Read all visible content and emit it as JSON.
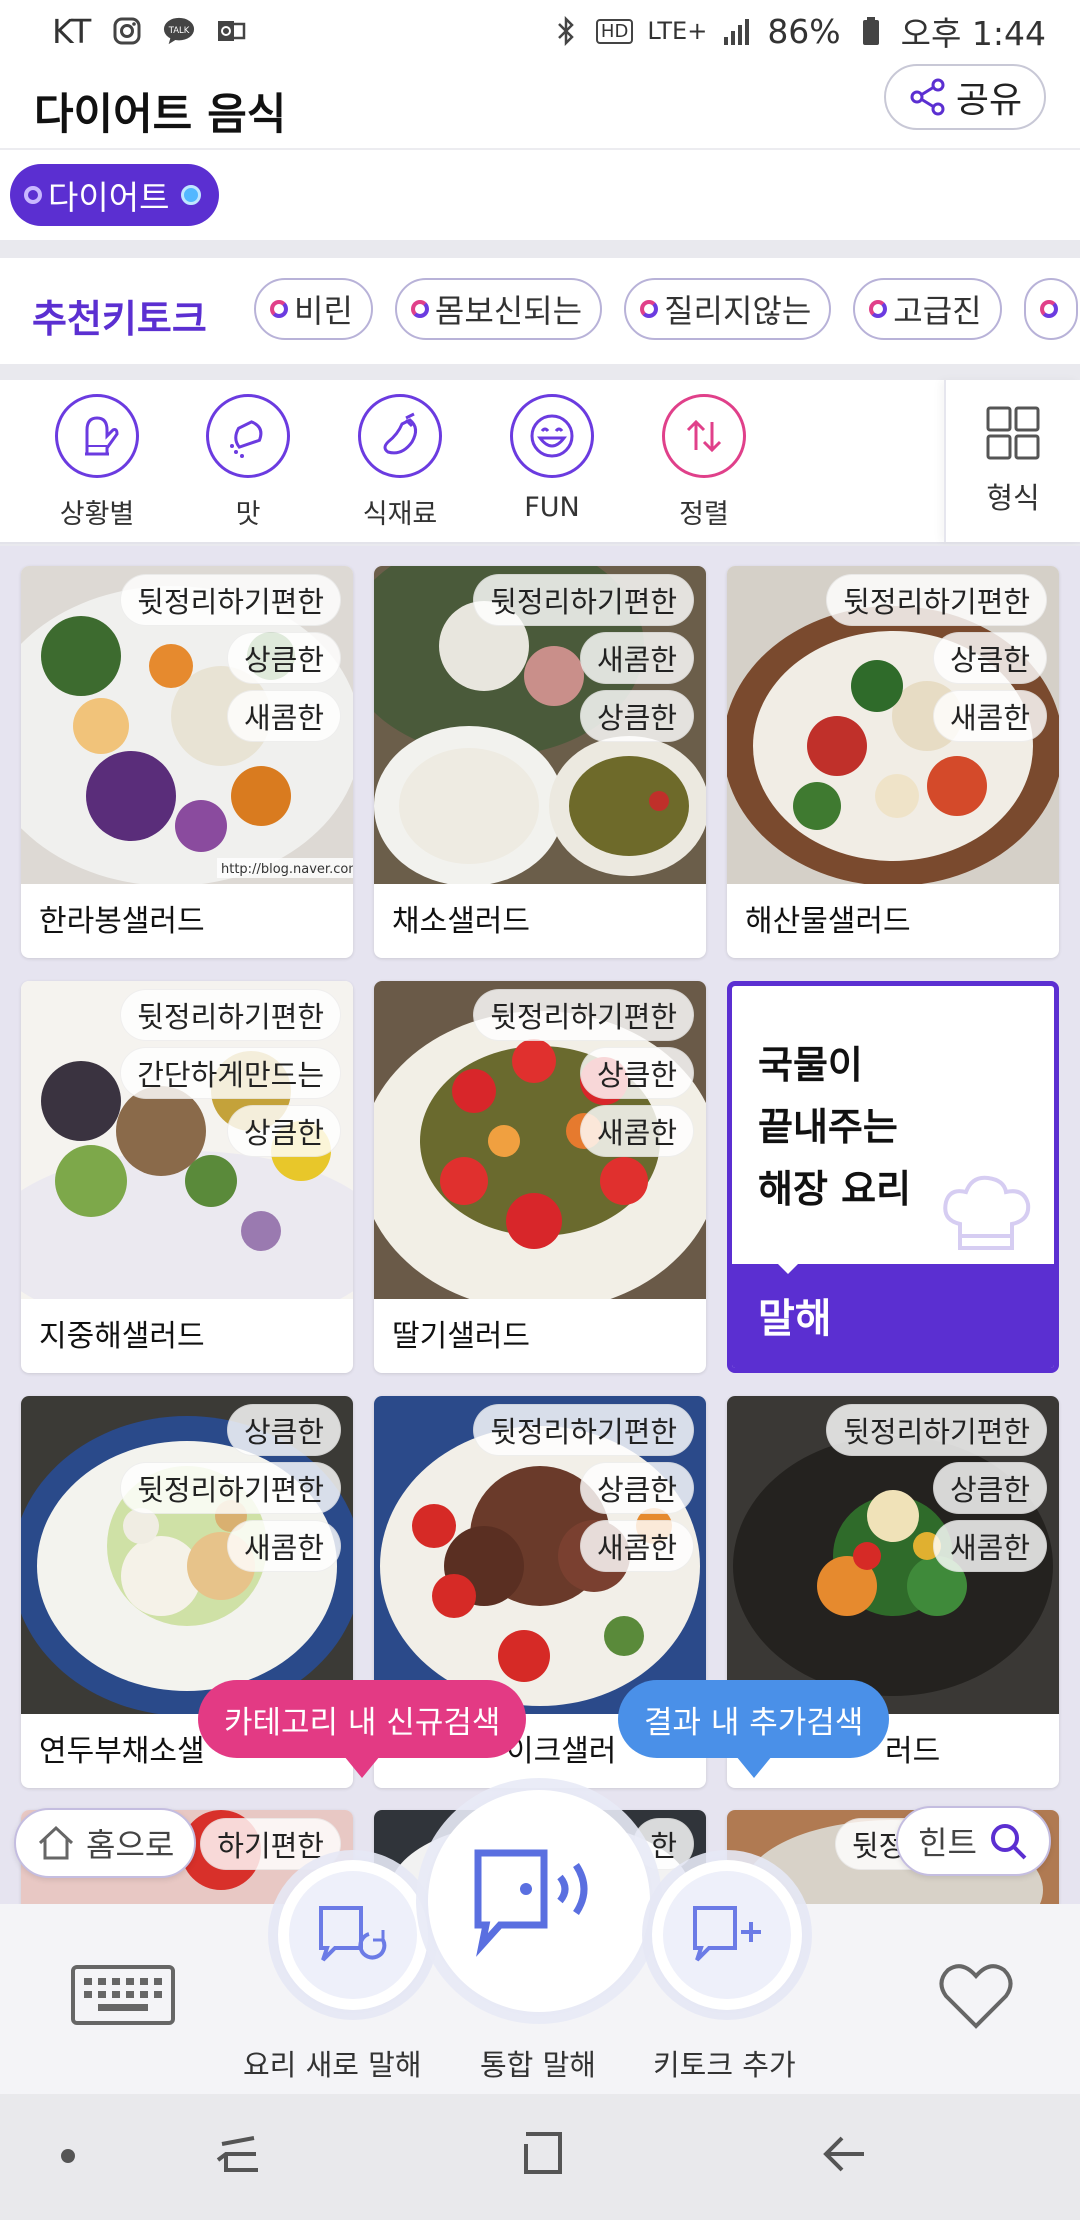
{
  "status": {
    "carrier": "KT",
    "battery": "86%",
    "time": "오후 1:44",
    "network": "LTE+",
    "hd": "HD",
    "talk_badge": "TALK"
  },
  "header": {
    "title": "다이어트 음식",
    "share_label": "공유"
  },
  "filter": {
    "active_chip": "다이어트"
  },
  "keytalk": {
    "label": "추천키토크",
    "chips": [
      "비린",
      "몸보신되는",
      "질리지않는",
      "고급진"
    ]
  },
  "categories": {
    "items": [
      {
        "label": "상황별",
        "icon": "mitten-icon"
      },
      {
        "label": "맛",
        "icon": "salt-shaker-icon"
      },
      {
        "label": "식재료",
        "icon": "eggplant-icon"
      },
      {
        "label": "FUN",
        "icon": "laughing-face-icon"
      },
      {
        "label": "정렬",
        "icon": "sort-arrows-icon"
      }
    ],
    "form_label": "형식"
  },
  "cards": [
    {
      "name": "한라봉샐러드",
      "tags": [
        "뒷정리하기편한",
        "상큼한",
        "새콤한"
      ],
      "watermark": "http://blog.naver.com/"
    },
    {
      "name": "채소샐러드",
      "tags": [
        "뒷정리하기편한",
        "새콤한",
        "상큼한"
      ]
    },
    {
      "name": "해산물샐러드",
      "tags": [
        "뒷정리하기편한",
        "상큼한",
        "새콤한"
      ]
    },
    {
      "name": "지중해샐러드",
      "tags": [
        "뒷정리하기편한",
        "간단하게만드는",
        "상큼한"
      ]
    },
    {
      "name": "딸기샐러드",
      "tags": [
        "뒷정리하기편한",
        "상큼한",
        "새콤한"
      ]
    },
    {
      "name": "연두부채소샐",
      "tags": [
        "상큼한",
        "뒷정리하기편한",
        "새콤한"
      ]
    },
    {
      "name": "이크샐러",
      "tags": [
        "뒷정리하기편한",
        "상큼한",
        "새콤한"
      ]
    },
    {
      "name": "러드",
      "tags": [
        "뒷정리하기편한",
        "상큼한",
        "새콤한"
      ]
    }
  ],
  "partial_row": {
    "tag_left": "하기편한",
    "tag_mid": "한",
    "tag_right": "뒷정리"
  },
  "ad_card": {
    "title": "국물이\n끝내주는\n해장 요리",
    "label": "말해"
  },
  "overlays": {
    "bubble_category": "카테고리 내 신규검색",
    "bubble_result": "결과 내 추가검색",
    "home_label": "홈으로",
    "hint_label": "힌트"
  },
  "voice": {
    "left_label": "요리 새로 말해",
    "center_label": "통합 말해",
    "right_label": "키토크 추가"
  },
  "colors": {
    "accent": "#5b2fd1",
    "pink": "#e33a84",
    "blue": "#4a90e8"
  }
}
